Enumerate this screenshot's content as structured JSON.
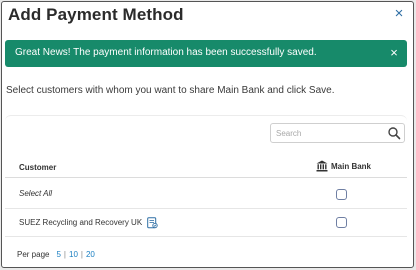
{
  "dialog": {
    "title": "Add Payment Method",
    "close_glyph": "×"
  },
  "alert": {
    "message": "Great News! The payment information has been successfully saved.",
    "close_glyph": "×",
    "color": "#178a6a"
  },
  "instruction": "Select customers with whom you want to share Main Bank and click Save.",
  "search": {
    "placeholder": "Search",
    "icon": "search-icon"
  },
  "table": {
    "headers": {
      "customer": "Customer",
      "bank": "Main Bank",
      "bank_icon": "bank-icon"
    },
    "rows": [
      {
        "label": "Select All",
        "checked": false
      },
      {
        "label": "SUEZ Recycling and Recovery UK",
        "checked": false,
        "icon": "document-icon"
      }
    ]
  },
  "pager": {
    "label": "Per page",
    "options": [
      "5",
      "10",
      "20"
    ]
  }
}
